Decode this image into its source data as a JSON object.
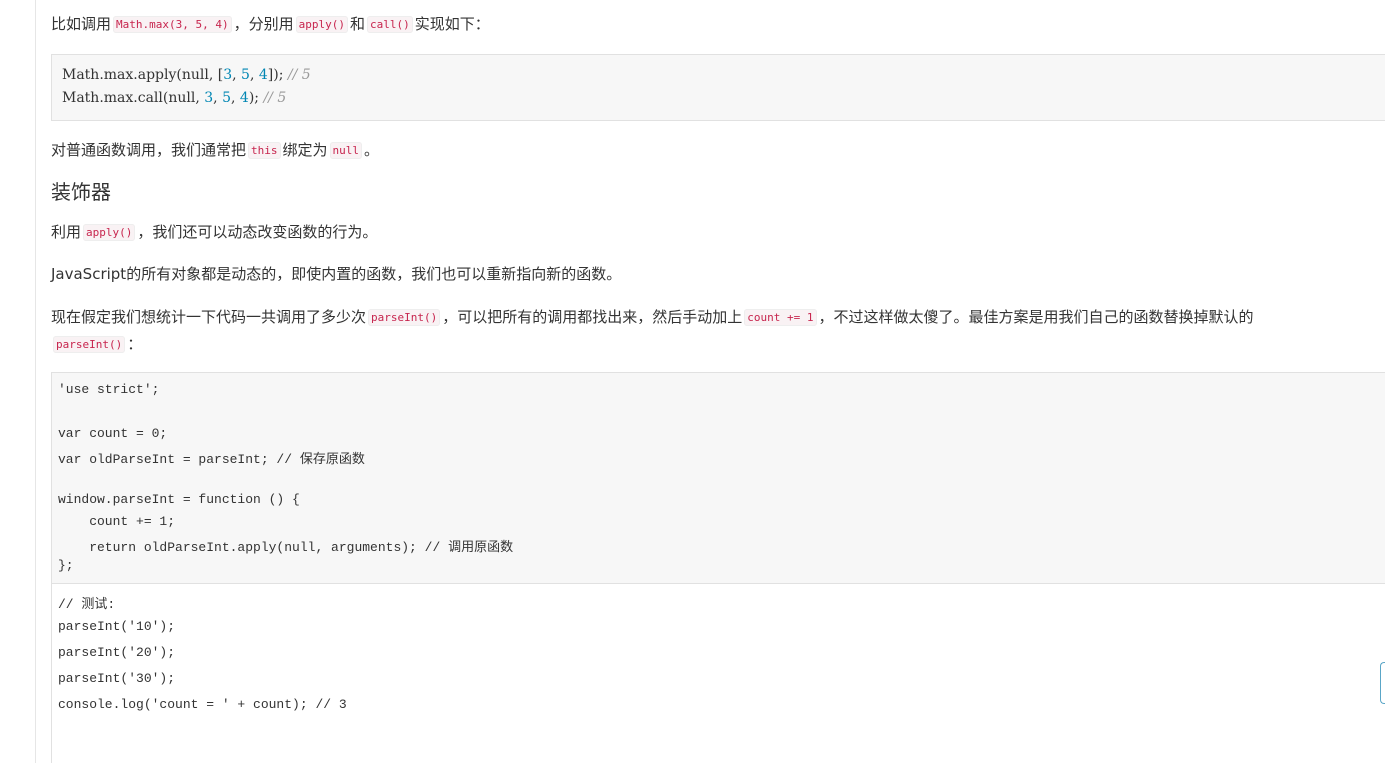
{
  "para1": {
    "t1": "比如调用",
    "code1": "Math.max(3, 5, 4)",
    "t2": "，分别用",
    "code2": "apply()",
    "t3": "和",
    "code3": "call()",
    "t4": "实现如下："
  },
  "code_block_1": {
    "line1": {
      "pre": "Math.max.apply(null, [",
      "n1": "3",
      "s1": ", ",
      "n2": "5",
      "s2": ", ",
      "n3": "4",
      "post": "]); ",
      "comment": "// 5"
    },
    "line2": {
      "pre": "Math.max.call(null, ",
      "n1": "3",
      "s1": ", ",
      "n2": "5",
      "s2": ", ",
      "n3": "4",
      "post": "); ",
      "comment": "// 5"
    }
  },
  "para2": {
    "t1": "对普通函数调用，我们通常把",
    "code1": "this",
    "t2": "绑定为",
    "code2": "null",
    "t3": "。"
  },
  "heading": "装饰器",
  "para3": {
    "t1": "利用",
    "code1": "apply()",
    "t2": "，我们还可以动态改变函数的行为。"
  },
  "para4": "JavaScript的所有对象都是动态的，即使内置的函数，我们也可以重新指向新的函数。",
  "para5": {
    "t1": "现在假定我们想统计一下代码一共调用了多少次",
    "code1": "parseInt()",
    "t2": "，可以把所有的调用都找出来，然后手动加上",
    "code2": "count += 1",
    "t3": "，不过这样做太傻了。最佳方案是用我们自己的函数替换掉默认的",
    "code3": "parseInt()",
    "t4": "："
  },
  "code_block_2": {
    "lines": [
      "'use strict';",
      "",
      "var count = 0;",
      "var oldParseInt = parseInt; // 保存原函数",
      "",
      "window.parseInt = function () {",
      "    count += 1;",
      "    return oldParseInt.apply(null, arguments); // 调用原函数",
      "};"
    ]
  },
  "code_block_3": {
    "lines": [
      "// 测试:",
      "parseInt('10');",
      "parseInt('20');",
      "parseInt('30');",
      "console.log('count = ' + count); // 3"
    ]
  }
}
